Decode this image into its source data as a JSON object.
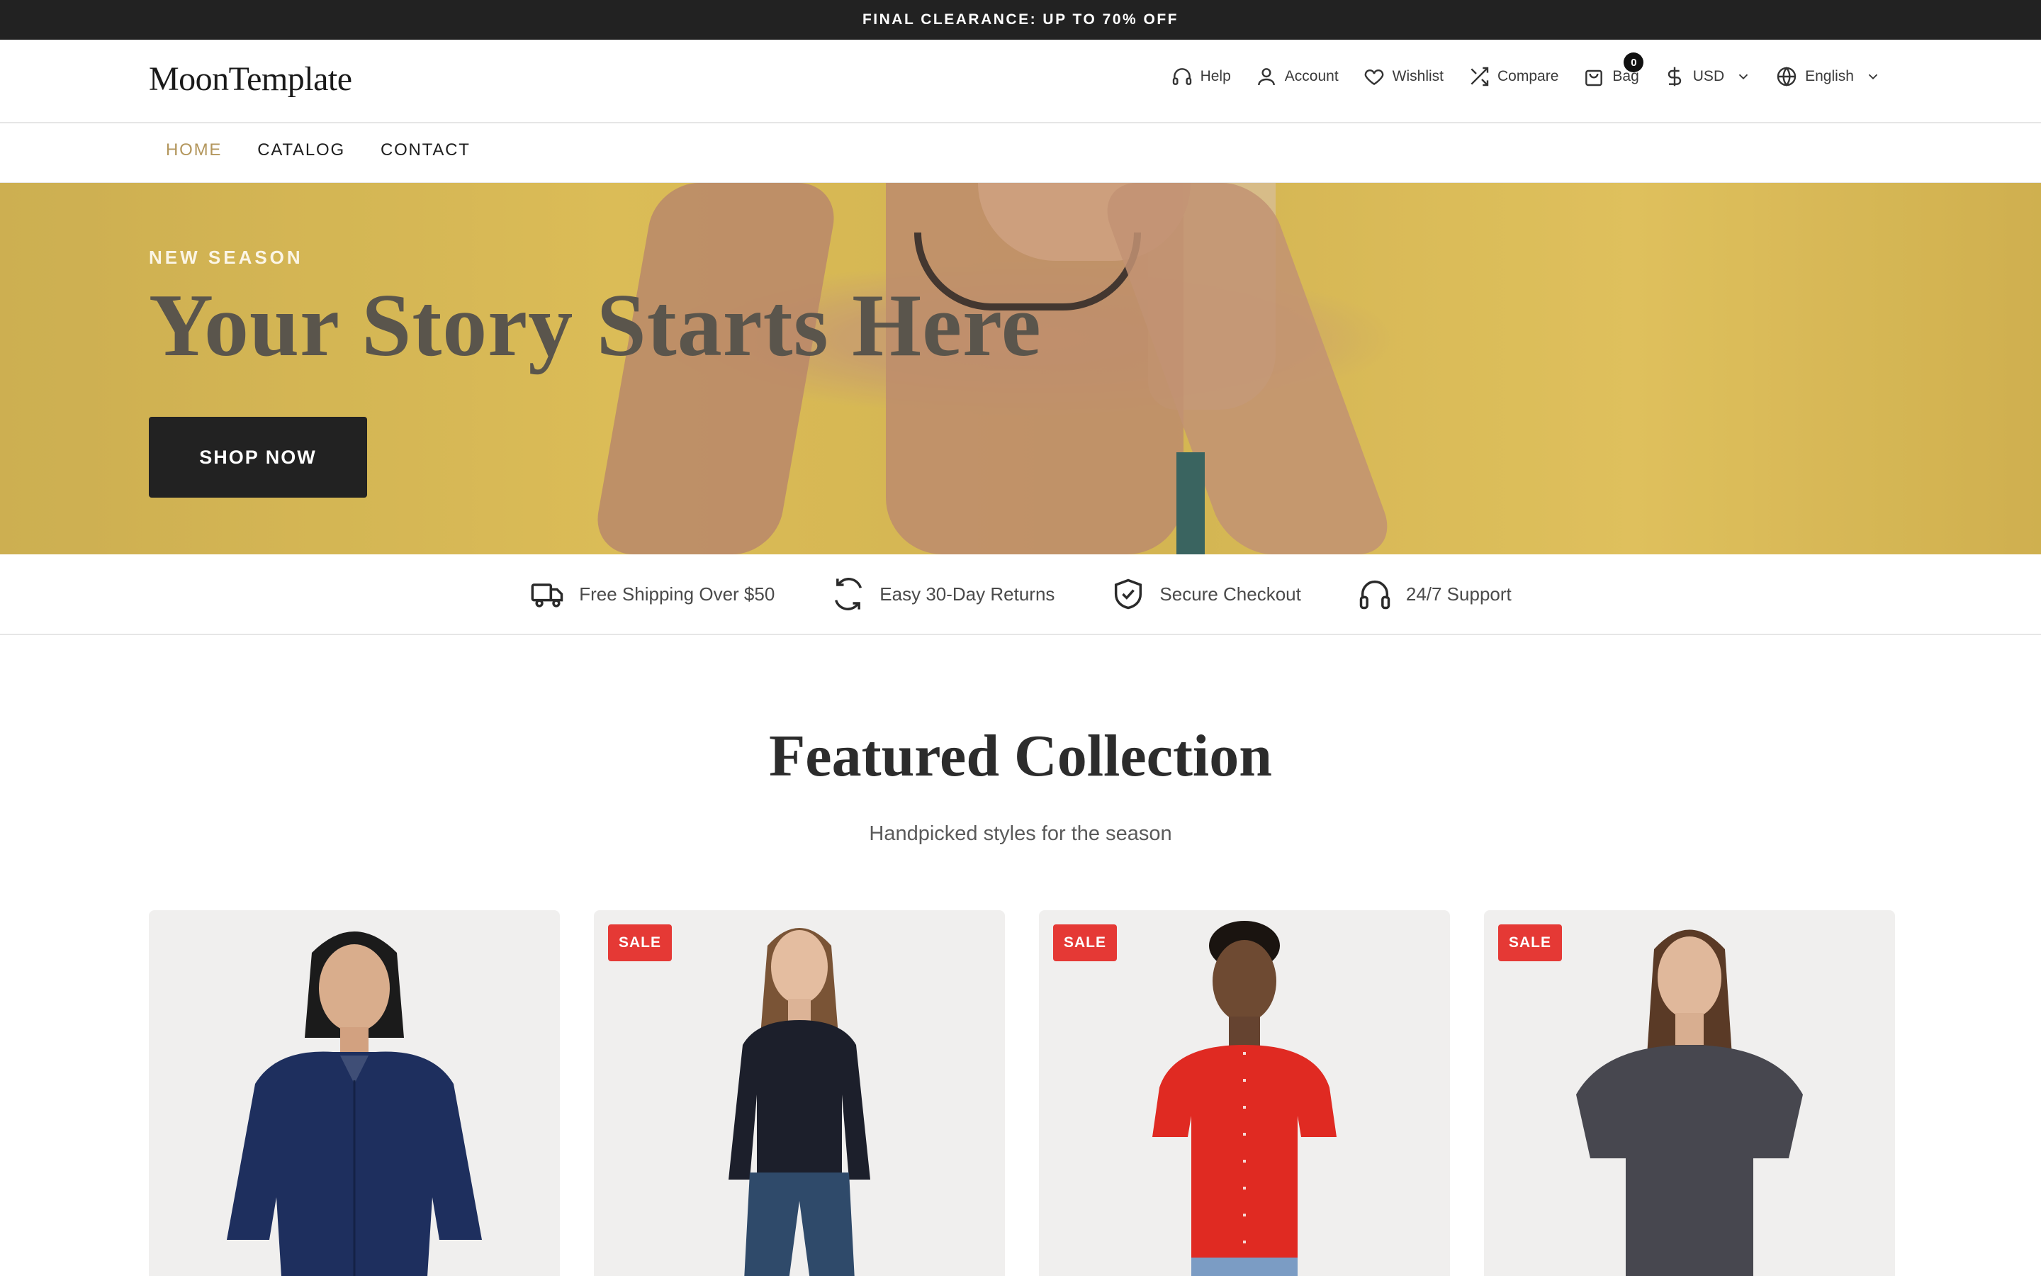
{
  "announcement": "FINAL CLEARANCE: UP TO 70% OFF",
  "header": {
    "logo": "MoonTemplate",
    "links": {
      "help": "Help",
      "account": "Account",
      "wishlist": "Wishlist",
      "compare": "Compare",
      "bag": "Bag",
      "bag_count": "0",
      "currency": "USD",
      "language": "English"
    }
  },
  "nav": {
    "items": [
      "HOME",
      "CATALOG",
      "CONTACT"
    ],
    "active": "HOME"
  },
  "hero": {
    "eyebrow": "NEW SEASON",
    "title": "Your Story Starts Here",
    "button": "SHOP NOW"
  },
  "features": [
    {
      "icon": "truck-icon",
      "label": "Free Shipping Over $50"
    },
    {
      "icon": "refresh-icon",
      "label": "Easy 30-Day Returns"
    },
    {
      "icon": "shield-check-icon",
      "label": "Secure Checkout"
    },
    {
      "icon": "headphones-icon",
      "label": "24/7 Support"
    }
  ],
  "featured": {
    "title": "Featured Collection",
    "subtitle": "Handpicked styles for the season"
  },
  "products": [
    {
      "badge": "",
      "garment": "navy-shirt",
      "color": "#1e2f5e"
    },
    {
      "badge": "SALE",
      "garment": "black-henley",
      "color": "#1c1f2b"
    },
    {
      "badge": "SALE",
      "garment": "red-cardigan",
      "color": "#e02a22"
    },
    {
      "badge": "SALE",
      "garment": "charcoal-tee",
      "color": "#47474f"
    }
  ],
  "colors": {
    "announcement_bg": "#222222",
    "accent": "#b3965c",
    "sale": "#e53935",
    "button": "#222222"
  }
}
